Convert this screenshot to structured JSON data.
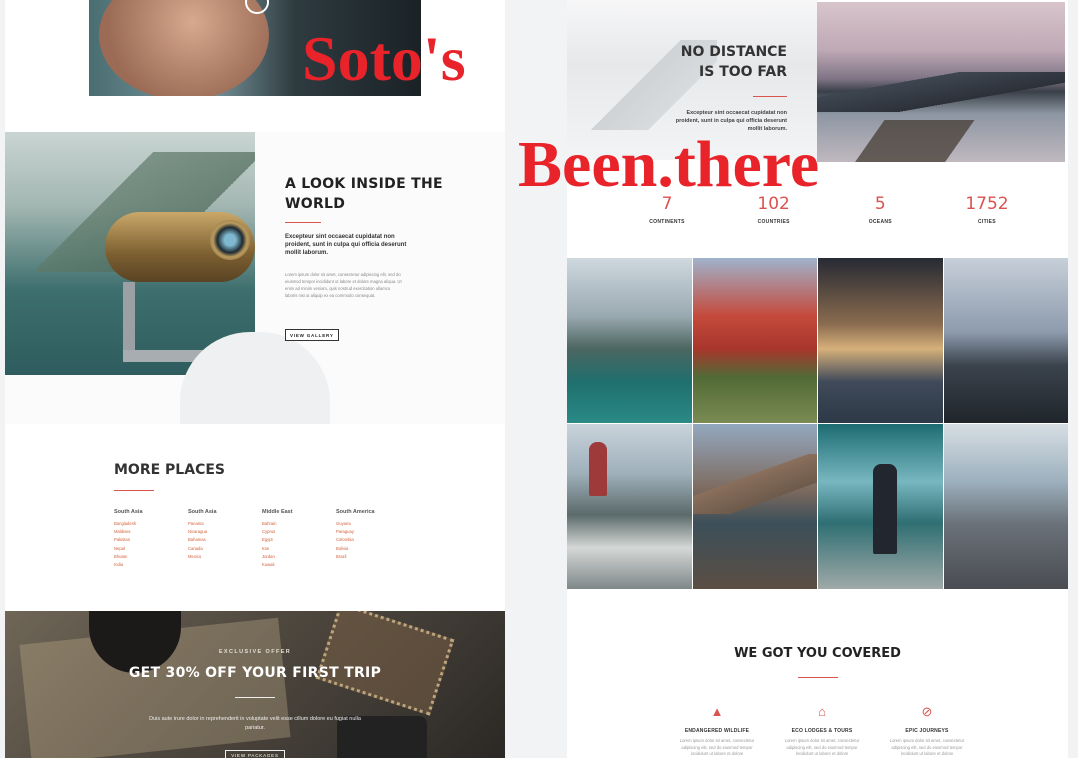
{
  "overlay": {
    "title": "Soto's",
    "subtitle": "Been.there"
  },
  "look": {
    "title": "A LOOK INSIDE THE WORLD",
    "lead": "Excepteur sint occaecat cupidatat non proident, sunt in culpa qui officia deserunt mollit laborum.",
    "body": "Lorem ipsum dolor sit amet, consectetur adipiscing elit, sed do eiusmod tempor incididunt ut labore et dolore magna aliqua. Ut enim ad minim veniam, quis nostrud exercitation ullamco laboris nisi ut aliquip ex ea commodo consequat.",
    "button": "VIEW GALLERY"
  },
  "places": {
    "title": "MORE PLACES",
    "columns": [
      {
        "region": "South Asia",
        "countries": [
          "Bangladesh",
          "Maldives",
          "Pakistan",
          "Nepal",
          "Bhutan",
          "India"
        ]
      },
      {
        "region": "South Asia",
        "countries": [
          "Panama",
          "Nicaragua",
          "Bahamas",
          "Canada",
          "Mexico"
        ]
      },
      {
        "region": "Middle East",
        "countries": [
          "Bahrain",
          "Cyprus",
          "Egypt",
          "Iran",
          "Jordan",
          "Kuwait"
        ]
      },
      {
        "region": "South America",
        "countries": [
          "Guyana",
          "Paraguay",
          "Colombia",
          "Bolivia",
          "Brazil"
        ]
      }
    ]
  },
  "offer": {
    "eyebrow": "EXCLUSIVE OFFER",
    "title": "GET 30% OFF YOUR FIRST TRIP",
    "text": "Duis aute irure dolor in reprehenderit in voluptate velit esse cillum dolore eu fugiat nulla pariatur.",
    "button": "VIEW PACKAGES"
  },
  "nodistance": {
    "title": "NO DISTANCE IS TOO FAR",
    "body": "Excepteur sint occaecat cupidatat non proident, sunt in culpa qui officia deserunt mollit laborum."
  },
  "stats": [
    {
      "value": "7",
      "label": "CONTINENTS"
    },
    {
      "value": "102",
      "label": "COUNTRIES"
    },
    {
      "value": "5",
      "label": "OCEANS"
    },
    {
      "value": "1752",
      "label": "CITIES"
    }
  ],
  "covered": {
    "title": "WE GOT YOU COVERED",
    "features": [
      {
        "icon": "warning-cone-icon",
        "glyph": "▲",
        "title": "ENDANGERED WILDLIFE",
        "text": "Lorem ipsum dolor sit amet, consectetur adipiscing elit, sed do eiusmod tempor incididunt ut labore et dolore"
      },
      {
        "icon": "home-icon",
        "glyph": "⌂",
        "title": "ECO LODGES & TOURS",
        "text": "Lorem ipsum dolor sit amet, consectetur adipiscing elit, sed do eiusmod tempor incididunt ut labore et dolore"
      },
      {
        "icon": "compass-icon",
        "glyph": "⊘",
        "title": "EPIC JOURNEYS",
        "text": "Lorem ipsum dolor sit amet, consectetur adipiscing elit, sed do eiusmod tempor incididunt ut labore et dolore"
      }
    ]
  },
  "colors": {
    "accent": "#d9534f",
    "overlay": "#e8232a",
    "link": "#d0603a"
  }
}
